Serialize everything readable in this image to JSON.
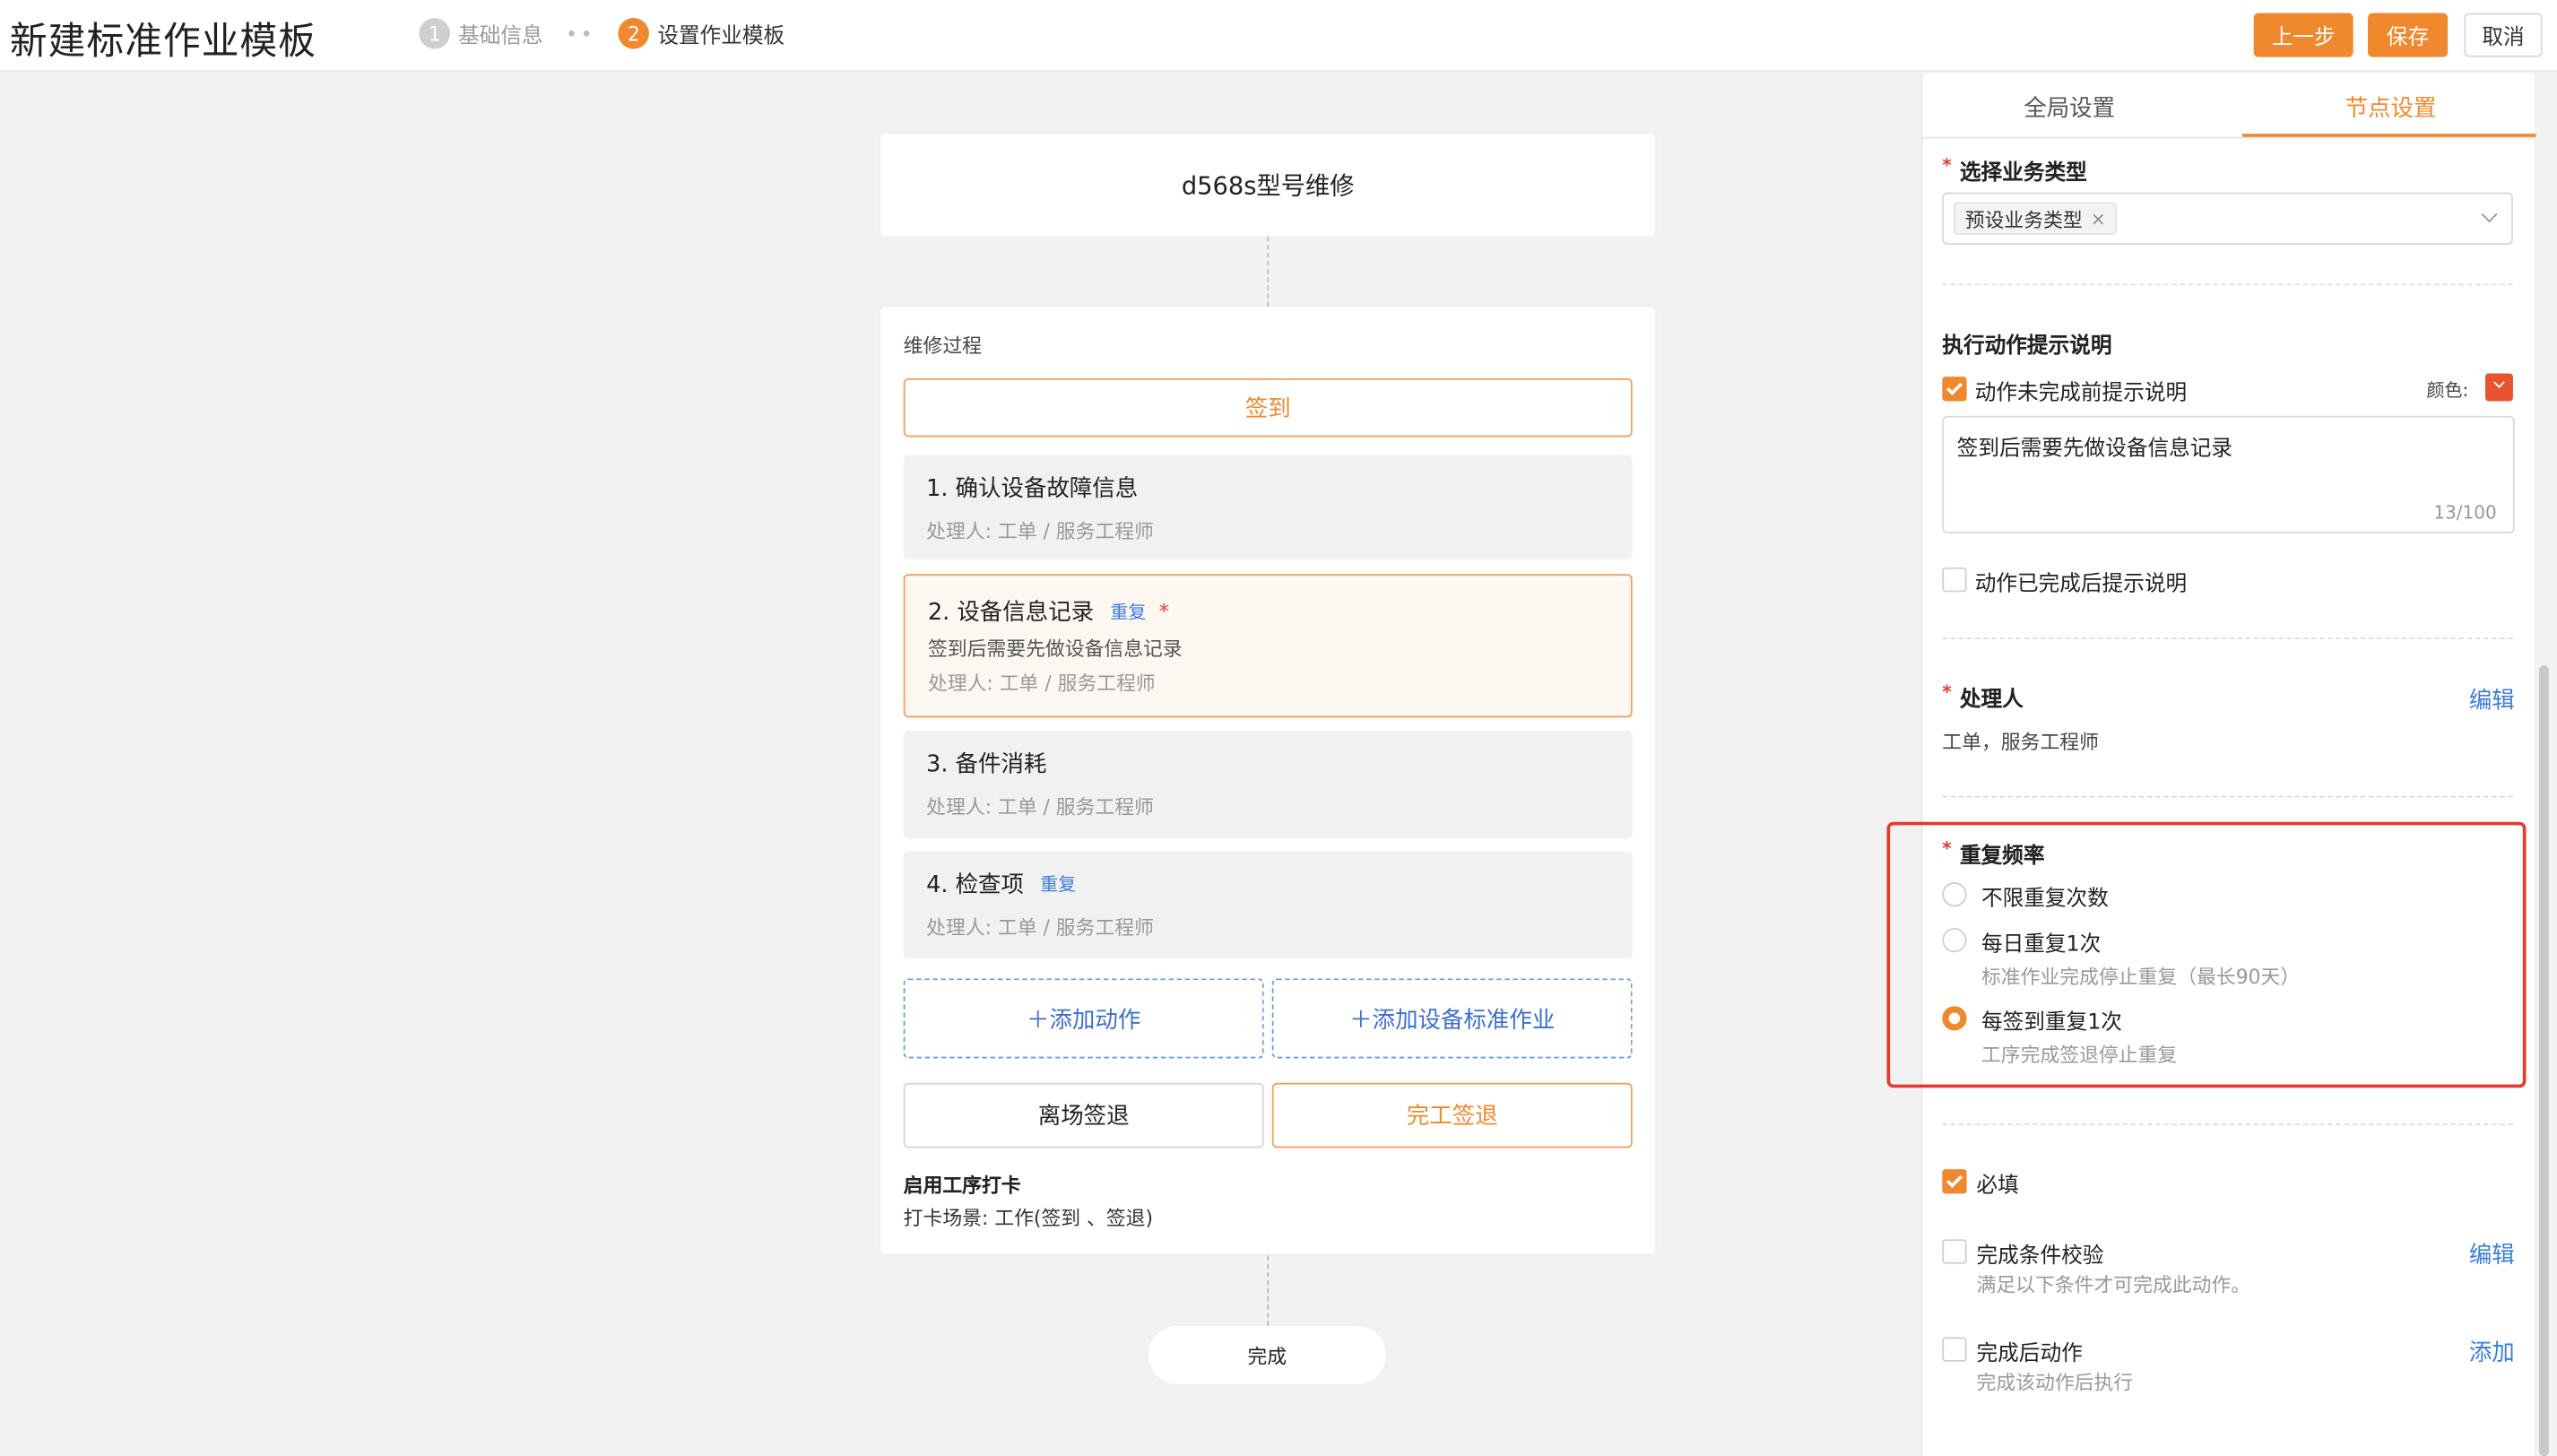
{
  "header": {
    "title": "新建标准作业模板",
    "steps": [
      {
        "num": "1",
        "label": "基础信息"
      },
      {
        "num": "2",
        "label": "设置作业模板"
      }
    ],
    "step_separator": "••",
    "prev_label": "上一步",
    "save_label": "保存",
    "cancel_label": "取消"
  },
  "flow": {
    "title": "d568s型号维修",
    "process_label": "维修过程",
    "signin_label": "签到",
    "actions": [
      {
        "title": "1. 确认设备故障信息",
        "handler": "处理人:  工单 / 服务工程师"
      },
      {
        "title": "2. 设备信息记录",
        "tag": "重复",
        "required": "*",
        "desc": "签到后需要先做设备信息记录",
        "handler": "处理人:  工单 / 服务工程师"
      },
      {
        "title": "3. 备件消耗",
        "handler": "处理人:  工单 / 服务工程师"
      },
      {
        "title": "4. 检查项",
        "tag": "重复",
        "handler": "处理人:  工单 / 服务工程师"
      }
    ],
    "add_action": "＋添加动作",
    "add_standard": "＋添加设备标准作业",
    "leave_signout": "离场签退",
    "finish_signout": "完工签退",
    "punch_title": "启用工序打卡",
    "punch_scene": "打卡场景:  工作(签到 、签退)",
    "done_label": "完成"
  },
  "panel": {
    "tabs": [
      "全局设置",
      "节点设置"
    ],
    "active_tab": "节点设置",
    "business_type": {
      "required": "*",
      "label": "选择业务类型",
      "chip": "预设业务类型",
      "chip_close": "×"
    },
    "hint": {
      "section_title": "执行动作提示说明",
      "before_label": "动作未完成前提示说明",
      "before_checked": true,
      "color_label": "颜色:",
      "color_value": "#e8542d",
      "textarea_value": "签到后需要先做设备信息记录",
      "counter": "13/100",
      "after_label": "动作已完成后提示说明",
      "after_checked": false
    },
    "handler": {
      "required": "*",
      "label": "处理人",
      "edit": "编辑",
      "value": "工单，服务工程师"
    },
    "repeat": {
      "required": "*",
      "label": "重复频率",
      "options": [
        {
          "label": "不限重复次数",
          "sub": "",
          "checked": false
        },
        {
          "label": "每日重复1次",
          "sub": "标准作业完成停止重复（最长90天）",
          "checked": false
        },
        {
          "label": "每签到重复1次",
          "sub": "工序完成签退停止重复",
          "checked": true
        }
      ]
    },
    "required_field": {
      "label": "必填",
      "checked": true
    },
    "condition": {
      "label": "完成条件校验",
      "sub": "满足以下条件才可完成此动作。",
      "edit": "编辑",
      "checked": false
    },
    "after_action": {
      "label": "完成后动作",
      "sub": "完成该动作后执行",
      "add": "添加",
      "checked": false
    }
  },
  "colors": {
    "accent": "#f0892d",
    "link": "#3b7ddd",
    "highlight_border": "#e8392d",
    "required_star": "#e23a2a"
  }
}
